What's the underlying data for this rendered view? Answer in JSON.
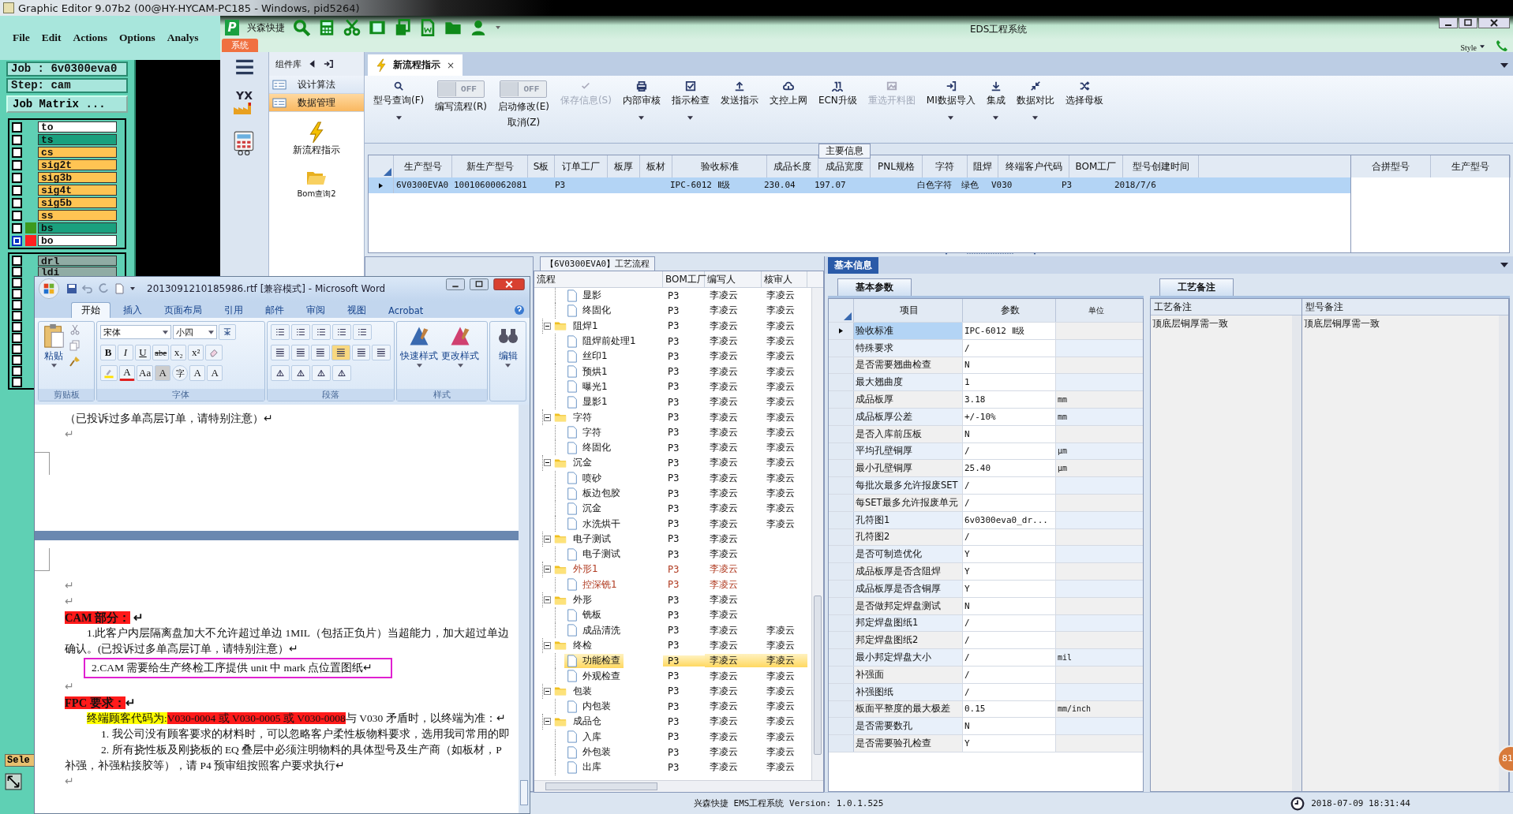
{
  "graphic_editor": {
    "title": "Graphic Editor 9.07b2 (00@HY-HYCAM-PC185 - Windows, pid5264)",
    "menu": [
      "File",
      "Edit",
      "Actions",
      "Options",
      "Analys"
    ],
    "job": "Job : 6v0300eva0",
    "step": "Step: cam",
    "matrix_button": "Job Matrix ...",
    "layers": [
      {
        "name": "to",
        "color": "#ffffff",
        "selected": false
      },
      {
        "name": "ts",
        "color": "#1aa07e",
        "selected": false
      },
      {
        "name": "cs",
        "color": "#ffc453",
        "selected": false
      },
      {
        "name": "sig2t",
        "color": "#ffc453",
        "selected": false
      },
      {
        "name": "sig3b",
        "color": "#ffc453",
        "selected": false
      },
      {
        "name": "sig4t",
        "color": "#ffc453",
        "selected": false
      },
      {
        "name": "sig5b",
        "color": "#ffc453",
        "selected": false
      },
      {
        "name": "ss",
        "color": "#ffc453",
        "selected": false
      },
      {
        "name": "bs",
        "color": "#1aa07e",
        "selected": false,
        "marker": {
          "color": "#3c9a1e"
        }
      },
      {
        "name": "bo",
        "color": "#ffffff",
        "selected": true,
        "marker": {
          "color": "#ff2020"
        }
      }
    ],
    "extra_layers": [
      {
        "name": "drl",
        "selected": false
      },
      {
        "name": "ldi",
        "selected": false
      }
    ],
    "empty_layers": [
      {
        "selected": false
      },
      {
        "selected": false
      },
      {
        "selected": false
      },
      {
        "selected": false
      },
      {
        "selected": false
      },
      {
        "selected": false
      },
      {
        "selected": false
      },
      {
        "selected": false
      },
      {
        "selected": false
      },
      {
        "selected": false
      }
    ],
    "select_button": "Sele"
  },
  "eds": {
    "logo": "P",
    "app_name": "兴森快捷",
    "title": "EDS工程系统",
    "menu_tab": "系统",
    "style_label": "Style",
    "nav_logo": "YX",
    "component_panel": {
      "title": "组件库",
      "items": [
        {
          "label": "设计算法",
          "selected": false
        },
        {
          "label": "数据管理",
          "selected": true
        }
      ],
      "tools": [
        "新流程指示",
        "Bom查询2"
      ]
    },
    "doc_tab": {
      "label": "新流程指示",
      "close": "×"
    },
    "ribbon": [
      {
        "kind": "button",
        "label": "型号查询(F)",
        "disabled": false,
        "dropdown": true
      },
      {
        "kind": "toggle",
        "label": "编写流程(R)",
        "state_text": "OFF",
        "on": false
      },
      {
        "kind": "toggle",
        "label": "启动修改(E)",
        "label2": "取消(Z)",
        "state_text": "OFF",
        "on": false
      },
      {
        "kind": "button",
        "label": "保存信息(S)",
        "disabled": true,
        "dropdown": false
      },
      {
        "kind": "button",
        "label": "内部审核",
        "disabled": false,
        "dropdown": true
      },
      {
        "kind": "button",
        "label": "指示检查",
        "disabled": false,
        "dropdown": true
      },
      {
        "kind": "button",
        "label": "发送指示",
        "disabled": false,
        "dropdown": false
      },
      {
        "kind": "button",
        "label": "文控上网",
        "disabled": false,
        "dropdown": false
      },
      {
        "kind": "button",
        "label": "ECN升级",
        "disabled": false,
        "dropdown": false
      },
      {
        "kind": "button",
        "label": "重选开料图",
        "disabled": true,
        "dropdown": false
      },
      {
        "kind": "button",
        "label": "MI数据导入",
        "disabled": false,
        "dropdown": true
      },
      {
        "kind": "button",
        "label": "集成",
        "disabled": false,
        "dropdown": true
      },
      {
        "kind": "button",
        "label": "数据对比",
        "disabled": false,
        "dropdown": true
      },
      {
        "kind": "button",
        "label": "选择母板",
        "disabled": false,
        "dropdown": false
      }
    ],
    "main_info": {
      "title": "主要信息",
      "columns": [
        "生产型号",
        "新生产型号",
        "S板",
        "订单工厂",
        "板厚",
        "板材",
        "验收标准",
        "成品长度",
        "成品宽度",
        "PNL规格",
        "字符",
        "阻焊",
        "终端客户代码",
        "BOM工厂",
        "型号创建时间"
      ],
      "rows": [
        {
          "selected": true,
          "cells": [
            "6V0300EVA0",
            "10010600062081",
            null,
            "P3",
            null,
            null,
            "IPC-6012 Ⅱ级",
            "230.04",
            "197.07",
            null,
            "白色字符",
            "绿色",
            "V030",
            "P3",
            "2018/7/6"
          ]
        }
      ],
      "side_columns": [
        "合拼型号",
        "生产型号"
      ]
    },
    "flow": {
      "title": "【6V0300EVA0】工艺流程",
      "columns": [
        "流程",
        "BOM工厂",
        "编写人",
        "核审人"
      ],
      "nodes": [
        {
          "kind": "file",
          "label": "显影",
          "factory": "P3",
          "writer": "李凌云",
          "reviewer": "李凌云",
          "selected": false,
          "flagged": false
        },
        {
          "kind": "file",
          "label": "终固化",
          "factory": "P3",
          "writer": "李凌云",
          "reviewer": "李凌云",
          "selected": false,
          "flagged": false
        },
        {
          "kind": "folder",
          "label": "阻焊1",
          "factory": "P3",
          "writer": "李凌云",
          "reviewer": "李凌云",
          "selected": false,
          "flagged": false,
          "expanded": true,
          "children": [
            {
              "kind": "file",
              "label": "阻焊前处理1",
              "factory": "P3",
              "writer": "李凌云",
              "reviewer": "李凌云",
              "selected": false,
              "flagged": false
            },
            {
              "kind": "file",
              "label": "丝印1",
              "factory": "P3",
              "writer": "李凌云",
              "reviewer": "李凌云",
              "selected": false,
              "flagged": false
            },
            {
              "kind": "file",
              "label": "预烘1",
              "factory": "P3",
              "writer": "李凌云",
              "reviewer": "李凌云",
              "selected": false,
              "flagged": false
            },
            {
              "kind": "file",
              "label": "曝光1",
              "factory": "P3",
              "writer": "李凌云",
              "reviewer": "李凌云",
              "selected": false,
              "flagged": false
            },
            {
              "kind": "file",
              "label": "显影1",
              "factory": "P3",
              "writer": "李凌云",
              "reviewer": "李凌云",
              "selected": false,
              "flagged": false
            }
          ]
        },
        {
          "kind": "folder",
          "label": "字符",
          "factory": "P3",
          "writer": "李凌云",
          "reviewer": "李凌云",
          "selected": false,
          "flagged": false,
          "expanded": true,
          "children": [
            {
              "kind": "file",
              "label": "字符",
              "factory": "P3",
              "writer": "李凌云",
              "reviewer": "李凌云",
              "selected": false,
              "flagged": false
            },
            {
              "kind": "file",
              "label": "终固化",
              "factory": "P3",
              "writer": "李凌云",
              "reviewer": "李凌云",
              "selected": false,
              "flagged": false
            }
          ]
        },
        {
          "kind": "folder",
          "label": "沉金",
          "factory": "P3",
          "writer": "李凌云",
          "reviewer": "李凌云",
          "selected": false,
          "flagged": false,
          "expanded": true,
          "children": [
            {
              "kind": "file",
              "label": "喷砂",
              "factory": "P3",
              "writer": "李凌云",
              "reviewer": "李凌云",
              "selected": false,
              "flagged": false
            },
            {
              "kind": "file",
              "label": "板边包胶",
              "factory": "P3",
              "writer": "李凌云",
              "reviewer": "李凌云",
              "selected": false,
              "flagged": false
            },
            {
              "kind": "file",
              "label": "沉金",
              "factory": "P3",
              "writer": "李凌云",
              "reviewer": "李凌云",
              "selected": false,
              "flagged": false
            },
            {
              "kind": "file",
              "label": "水洗烘干",
              "factory": "P3",
              "writer": "李凌云",
              "reviewer": "李凌云",
              "selected": false,
              "flagged": false
            }
          ]
        },
        {
          "kind": "folder",
          "label": "电子测试",
          "factory": "P3",
          "writer": "李凌云",
          "selected": false,
          "flagged": false,
          "expanded": true,
          "children": [
            {
              "kind": "file",
              "label": "电子测试",
              "factory": "P3",
              "writer": "李凌云",
              "selected": false,
              "flagged": false
            }
          ]
        },
        {
          "kind": "folder",
          "label": "外形1",
          "factory": "P3",
          "writer": "李凌云",
          "selected": false,
          "flagged": true,
          "expanded": true,
          "children": [
            {
              "kind": "file",
              "label": "控深铣1",
              "factory": "P3",
              "writer": "李凌云",
              "selected": false,
              "flagged": true
            }
          ]
        },
        {
          "kind": "folder",
          "label": "外形",
          "factory": "P3",
          "writer": "李凌云",
          "selected": false,
          "flagged": false,
          "expanded": true,
          "children": [
            {
              "kind": "file",
              "label": "铣板",
              "factory": "P3",
              "writer": "李凌云",
              "selected": false,
              "flagged": false
            },
            {
              "kind": "file",
              "label": "成品清洗",
              "factory": "P3",
              "writer": "李凌云",
              "reviewer": "李凌云",
              "selected": false,
              "flagged": false
            }
          ]
        },
        {
          "kind": "folder",
          "label": "终检",
          "factory": "P3",
          "writer": "李凌云",
          "reviewer": "李凌云",
          "selected": false,
          "flagged": false,
          "expanded": true,
          "children": [
            {
              "kind": "file",
              "label": "功能检查",
              "factory": "P3",
              "writer": "李凌云",
              "reviewer": "李凌云",
              "selected": true,
              "flagged": false
            },
            {
              "kind": "file",
              "label": "外观检查",
              "factory": "P3",
              "writer": "李凌云",
              "reviewer": "李凌云",
              "selected": false,
              "flagged": false
            }
          ]
        },
        {
          "kind": "folder",
          "label": "包装",
          "factory": "P3",
          "writer": "李凌云",
          "reviewer": "李凌云",
          "selected": false,
          "flagged": false,
          "expanded": true,
          "children": [
            {
              "kind": "file",
              "label": "内包装",
              "factory": "P3",
              "writer": "李凌云",
              "reviewer": "李凌云",
              "selected": false,
              "flagged": false
            }
          ]
        },
        {
          "kind": "folder",
          "label": "成品仓",
          "factory": "P3",
          "writer": "李凌云",
          "reviewer": "李凌云",
          "selected": false,
          "flagged": false,
          "expanded": true,
          "children": [
            {
              "kind": "file",
              "label": "入库",
              "factory": "P3",
              "writer": "李凌云",
              "reviewer": "李凌云",
              "selected": false,
              "flagged": false
            },
            {
              "kind": "file",
              "label": "外包装",
              "factory": "P3",
              "writer": "李凌云",
              "reviewer": "李凌云",
              "selected": false,
              "flagged": false
            },
            {
              "kind": "file",
              "label": "出库",
              "factory": "P3",
              "writer": "李凌云",
              "reviewer": "李凌云",
              "selected": false,
              "flagged": false
            }
          ]
        }
      ]
    },
    "basic": {
      "title": "基本信息",
      "params_tab": "基本参数",
      "columns": [
        "项目",
        "参数",
        "单位"
      ],
      "rows": [
        {
          "item": "验收标准",
          "value": "IPC-6012 Ⅱ级",
          "selected": true
        },
        {
          "item": "特殊要求",
          "value": "/",
          "selected": false
        },
        {
          "item": "是否需要翘曲检查",
          "value": "N",
          "selected": false
        },
        {
          "item": "最大翘曲度",
          "value": "1",
          "selected": false
        },
        {
          "item": "成品板厚",
          "value": "3.18",
          "unit": "mm",
          "selected": false
        },
        {
          "item": "成品板厚公差",
          "value": "+/-10%",
          "unit": "mm",
          "selected": false
        },
        {
          "item": "是否入库前压板",
          "value": "N",
          "selected": false
        },
        {
          "item": "平均孔壁铜厚",
          "value": "/",
          "unit": "μm",
          "selected": false
        },
        {
          "item": "最小孔壁铜厚",
          "value": "25.40",
          "unit": "μm",
          "selected": false
        },
        {
          "item": "每批次最多允许报废SET",
          "value": "/",
          "selected": false
        },
        {
          "item": "每SET最多允许报废单元",
          "value": "/",
          "selected": false
        },
        {
          "item": "孔符图1",
          "value": "6v0300eva0_dr...",
          "selected": false
        },
        {
          "item": "孔符图2",
          "value": "/",
          "selected": false
        },
        {
          "item": "是否可制造优化",
          "value": "Y",
          "selected": false
        },
        {
          "item": "成品板厚是否含阻焊",
          "value": "Y",
          "selected": false
        },
        {
          "item": "成品板厚是否含铜厚",
          "value": "Y",
          "selected": false
        },
        {
          "item": "是否做邦定焊盘测试",
          "value": "N",
          "selected": false
        },
        {
          "item": "邦定焊盘图纸1",
          "value": "/",
          "selected": false
        },
        {
          "item": "邦定焊盘图纸2",
          "value": "/",
          "selected": false
        },
        {
          "item": "最小邦定焊盘大小",
          "value": "/",
          "unit": "mil",
          "selected": false
        },
        {
          "item": "补强面",
          "value": "/",
          "selected": false
        },
        {
          "item": "补强图纸",
          "value": "/",
          "selected": false
        },
        {
          "item": "板面平整度的最大极差",
          "value": "0.15",
          "unit": "mm/inch",
          "selected": false
        },
        {
          "item": "是否需要数孔",
          "value": "N",
          "selected": false
        },
        {
          "item": "是否需要验孔检查",
          "value": "Y",
          "selected": false
        }
      ],
      "notes_tab": "工艺备注",
      "notes_columns": [
        "工艺备注",
        "型号备注"
      ],
      "notes": [
        "顶底层铜厚需一致",
        "顶底层铜厚需一致"
      ]
    },
    "status": {
      "text": "兴森快捷 EMS工程系统 Version: 1.0.1.525",
      "time": "2018-07-09 18:31:44"
    },
    "badge": "81"
  },
  "word": {
    "title": "2013091210185986.rtf [兼容模式] - Microsoft Word",
    "tabs": [
      {
        "label": "开始",
        "selected": true
      },
      {
        "label": "插入",
        "selected": false
      },
      {
        "label": "页面布局",
        "selected": false
      },
      {
        "label": "引用",
        "selected": false
      },
      {
        "label": "邮件",
        "selected": false
      },
      {
        "label": "审阅",
        "selected": false
      },
      {
        "label": "视图",
        "selected": false
      },
      {
        "label": "Acrobat",
        "selected": false
      }
    ],
    "paste": "粘贴",
    "font": "宋体",
    "size": "小四",
    "font_keys": [
      "B",
      "I",
      "U",
      "abe",
      "x₂",
      "x²"
    ],
    "font_keys2": [
      "A",
      "Aa",
      "A",
      "字",
      "A",
      "A"
    ],
    "styles": [
      "快速样式",
      "更改样式"
    ],
    "edit": "编辑",
    "groups": [
      "剪贴板",
      "字体",
      "段落",
      "样式"
    ],
    "pages": [
      {
        "paragraphs": [
          {
            "kind": "text",
            "segments": [
              {
                "text": "（已投诉过多单高层订单，请特别注意）↵"
              }
            ]
          },
          {
            "kind": "mark",
            "segments": [
              {
                "text": "↵"
              }
            ]
          }
        ]
      },
      {
        "paragraphs": [
          {
            "kind": "mark",
            "segments": [
              {
                "text": "↵"
              }
            ]
          },
          {
            "kind": "mark",
            "segments": [
              {
                "text": "↵"
              }
            ]
          },
          {
            "kind": "heading",
            "segments": [
              {
                "text": "CAM 部分：",
                "color": "#ff1a1a"
              },
              {
                "text": " ↵"
              }
            ]
          },
          {
            "kind": "indent",
            "segments": [
              {
                "text": "1.此客户内层隔离盘加大不允许超过单边 1MIL（包括正负片）当超能力，加大超过单边"
              }
            ]
          },
          {
            "kind": "text",
            "segments": [
              {
                "text": "确认。(已投诉过多单高层订单，请特别注意）↵"
              }
            ]
          },
          {
            "kind": "boxed",
            "segments": [
              {
                "text": "2.CAM 需要给生产终检工序提供 unit 中 mark 点位置图纸↵"
              }
            ]
          },
          {
            "kind": "mark",
            "segments": [
              {
                "text": "↵"
              }
            ]
          },
          {
            "kind": "heading",
            "segments": [
              {
                "text": "FPC 要求：",
                "color": "#ff1a1a"
              },
              {
                "text": "↵"
              }
            ]
          },
          {
            "kind": "indent",
            "segments": [
              {
                "text": "终端顾客代码为:",
                "color": "#ffff00"
              },
              {
                "text": "V030-0004 或 V030-0005 或 V030-0008",
                "color": "#ff1a1a"
              },
              {
                "text": "与 V030 矛盾时，以终端为准：↵"
              }
            ]
          },
          {
            "kind": "list",
            "segments": [
              {
                "text": "1. 我公司没有顾客要求的材料时，可以忽略客户柔性板物料要求，选用我司常用的即"
              }
            ]
          },
          {
            "kind": "list",
            "segments": [
              {
                "text": "2. 所有挠性板及刚挠板的 EQ 叠层中必须注明物料的具体型号及生产商（如板材，P"
              }
            ]
          },
          {
            "kind": "text",
            "segments": [
              {
                "text": "补强，补强粘接胶等），请 P4 预审组按照客户要求执行↵"
              }
            ]
          },
          {
            "kind": "mark",
            "segments": [
              {
                "text": "↵"
              }
            ]
          }
        ]
      }
    ]
  }
}
